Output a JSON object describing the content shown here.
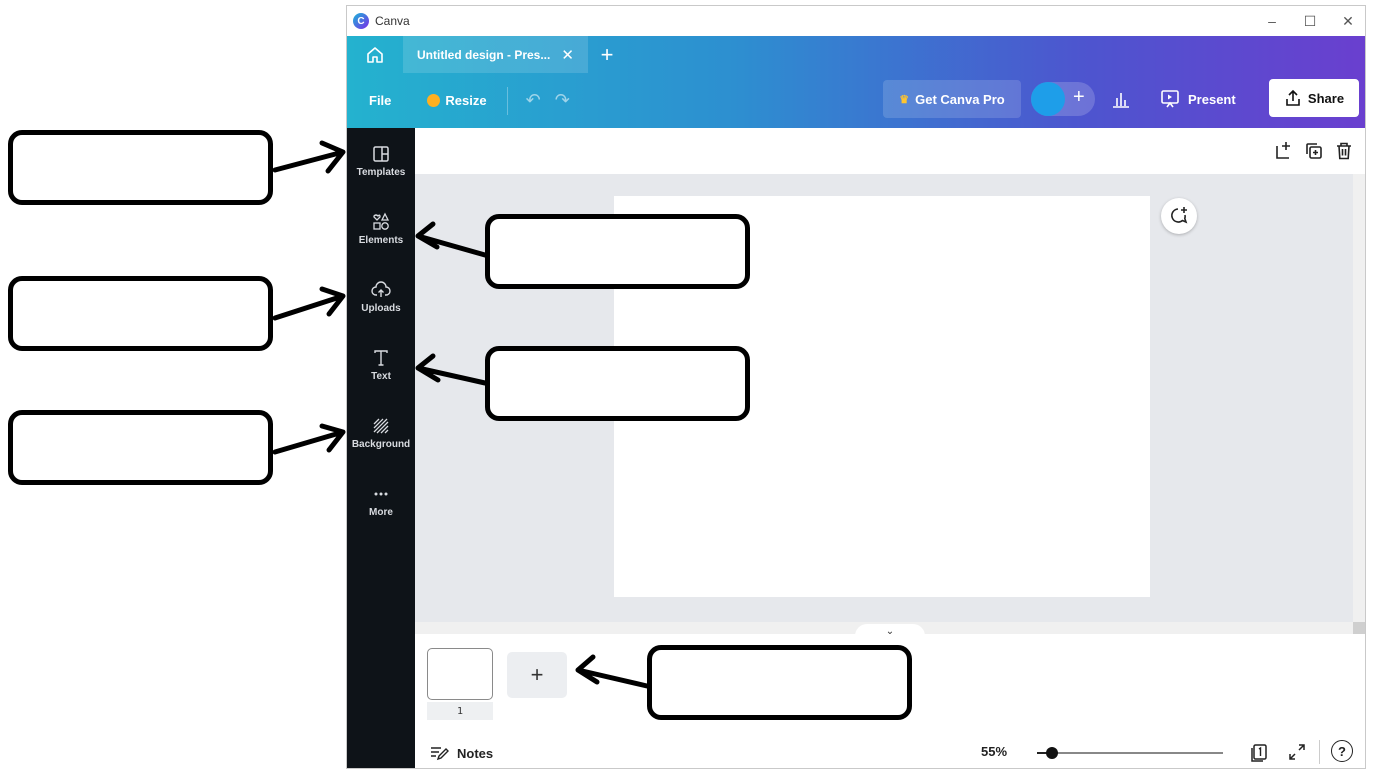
{
  "window": {
    "app_title": "Canva",
    "controls": {
      "minimize": "–",
      "maximize": "☐",
      "close": "✕"
    }
  },
  "tabs": {
    "doc_tab_label": "Untitled design - Pres...",
    "close_glyph": "✕",
    "new_tab_glyph": "+"
  },
  "toolbar": {
    "file_label": "File",
    "resize_label": "Resize",
    "undo_glyph": "↶",
    "redo_glyph": "↷",
    "get_pro_label": "Get Canva Pro",
    "crown_glyph": "♛",
    "add_member_glyph": "+",
    "present_label": "Present",
    "share_label": "Share"
  },
  "sidebar": {
    "items": [
      {
        "label": "Templates",
        "icon": "templates-icon"
      },
      {
        "label": "Elements",
        "icon": "elements-icon"
      },
      {
        "label": "Uploads",
        "icon": "uploads-icon"
      },
      {
        "label": "Text",
        "icon": "text-icon"
      },
      {
        "label": "Background",
        "icon": "background-icon"
      },
      {
        "label": "More",
        "icon": "more-icon"
      }
    ]
  },
  "canvas": {
    "collapse_glyph": "⌄"
  },
  "bottom": {
    "page_number": "1",
    "add_page_glyph": "+",
    "notes_label": "Notes",
    "zoom_label": "55%",
    "zoom_fraction": 0.08,
    "help_glyph": "?"
  },
  "colors": {
    "topbar_start": "#24b2cf",
    "topbar_end": "#6a3fcf",
    "sidebar_bg": "#0e1318",
    "canvas_bg": "#e6e8ec"
  }
}
